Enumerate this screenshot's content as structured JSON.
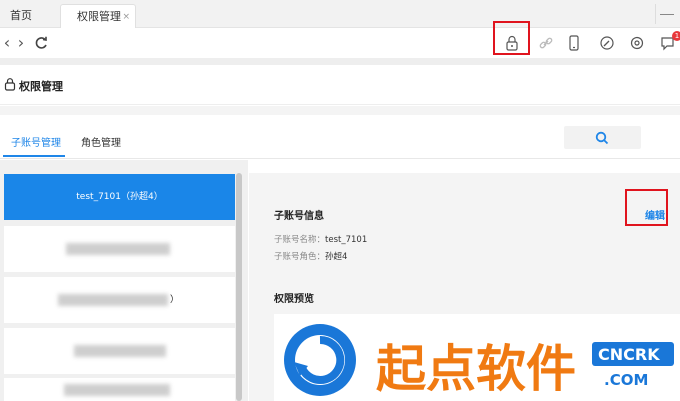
{
  "tabs": {
    "home": "首页",
    "active": "权限管理",
    "close": "×"
  },
  "page": {
    "title": "权限管理"
  },
  "subtabs": {
    "sub_accounts": "子账号管理",
    "roles": "角色管理"
  },
  "accounts": {
    "selected": "test_7101（孙超4）",
    "item3_suffix": "）"
  },
  "detail": {
    "section_title": "子账号信息",
    "edit": "编辑",
    "name_label": "子账号名称：",
    "name_value": "test_7101",
    "role_label": "子账号角色：",
    "role_value": "孙超4",
    "perm_title": "权限预览"
  },
  "watermark": {
    "cn": "起点软件",
    "en1": "CNCRK",
    "en2": ".COM"
  },
  "colors": {
    "accent": "#1f86e8",
    "highlight": "#e0141e",
    "selected_row": "#1a86e8"
  },
  "toolbar_icons": [
    "back-icon",
    "forward-icon",
    "refresh-icon",
    "lock-icon",
    "link-icon",
    "phone-icon",
    "speed-icon",
    "settings-icon",
    "chat-icon"
  ],
  "badge": {
    "count": "1"
  }
}
